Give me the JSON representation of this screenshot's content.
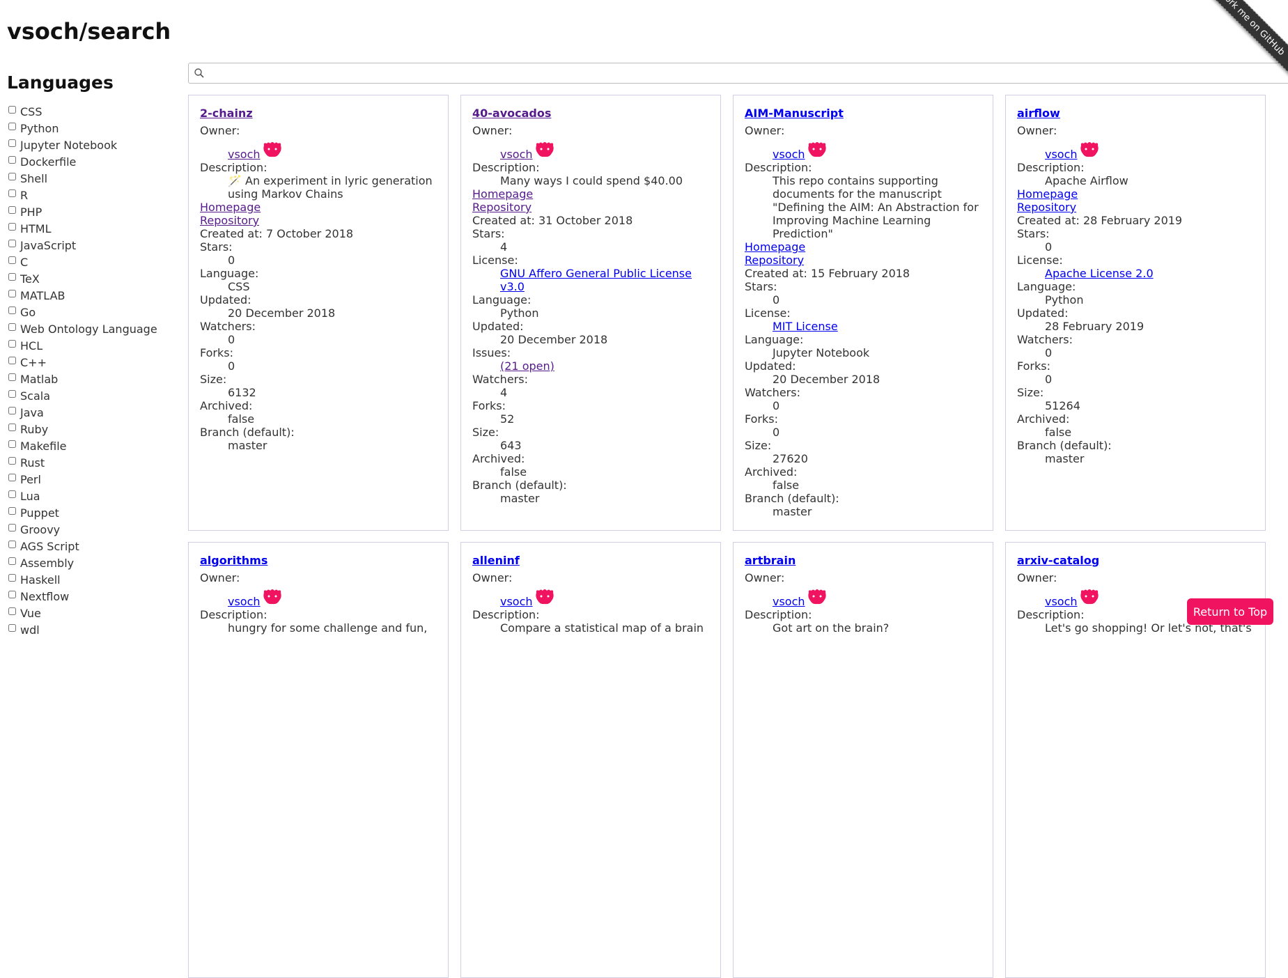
{
  "site_title": "vsoch/search",
  "sidebar": {
    "heading": "Languages",
    "languages": [
      "CSS",
      "Python",
      "Jupyter Notebook",
      "Dockerfile",
      "Shell",
      "R",
      "PHP",
      "HTML",
      "JavaScript",
      "C",
      "TeX",
      "MATLAB",
      "Go",
      "Web Ontology Language",
      "HCL",
      "C++",
      "Matlab",
      "Scala",
      "Java",
      "Ruby",
      "Makefile",
      "Rust",
      "Perl",
      "Lua",
      "Puppet",
      "Groovy",
      "AGS Script",
      "Assembly",
      "Haskell",
      "Nextflow",
      "Vue",
      "wdl"
    ]
  },
  "search": {
    "placeholder": ""
  },
  "fork_ribbon": "Fork me on GitHub",
  "return_top": "Return to Top",
  "labels": {
    "owner": "Owner:",
    "description": "Description:",
    "homepage": "Homepage",
    "repository": "Repository",
    "stars": "Stars:",
    "license": "License:",
    "language": "Language:",
    "updated": "Updated:",
    "issues": "Issues:",
    "watchers": "Watchers:",
    "forks": "Forks:",
    "size": "Size:",
    "archived": "Archived:",
    "branch": "Branch (default):"
  },
  "cards": [
    {
      "name": "2-chainz",
      "owner": "vsoch",
      "description": "🪄 An experiment in lyric generation using Markov Chains",
      "created": "Created at: 7 October 2018",
      "stars": "0",
      "license": "",
      "language": "CSS",
      "updated": "20 December 2018",
      "issues": "",
      "watchers": "0",
      "forks": "0",
      "size": "6132",
      "archived": "false",
      "branch": "master"
    },
    {
      "name": "40-avocados",
      "owner": "vsoch",
      "description": "Many ways I could spend $40.00",
      "created": "Created at: 31 October 2018",
      "stars": "4",
      "license": "GNU Affero General Public License v3.0",
      "language": "Python",
      "updated": "20 December 2018",
      "issues": "(21 open)",
      "watchers": "4",
      "forks": "52",
      "size": "643",
      "archived": "false",
      "branch": "master"
    },
    {
      "name": "AIM-Manuscript",
      "owner": "vsoch",
      "description": "This repo contains supporting documents for the manuscript \"Defining the AIM: An Abstraction for Improving Machine Learning Prediction\"",
      "created": "Created at: 15 February 2018",
      "stars": "0",
      "license": "MIT License",
      "language": "Jupyter Notebook",
      "updated": "20 December 2018",
      "issues": "",
      "watchers": "0",
      "forks": "0",
      "size": "27620",
      "archived": "false",
      "branch": "master"
    },
    {
      "name": "airflow",
      "owner": "vsoch",
      "description": "Apache Airflow",
      "created": "Created at: 28 February 2019",
      "stars": "0",
      "license": "Apache License 2.0",
      "language": "Python",
      "updated": "28 February 2019",
      "issues": "",
      "watchers": "0",
      "forks": "0",
      "size": "51264",
      "archived": "false",
      "branch": "master"
    },
    {
      "name": "algorithms",
      "owner": "vsoch",
      "description": "hungry for some challenge and fun,"
    },
    {
      "name": "alleninf",
      "owner": "vsoch",
      "description": "Compare a statistical map of a brain"
    },
    {
      "name": "artbrain",
      "owner": "vsoch",
      "description": "Got art on the brain?"
    },
    {
      "name": "arxiv-catalog",
      "owner": "vsoch",
      "description": "Let's go shopping! Or let's not, that's"
    }
  ]
}
